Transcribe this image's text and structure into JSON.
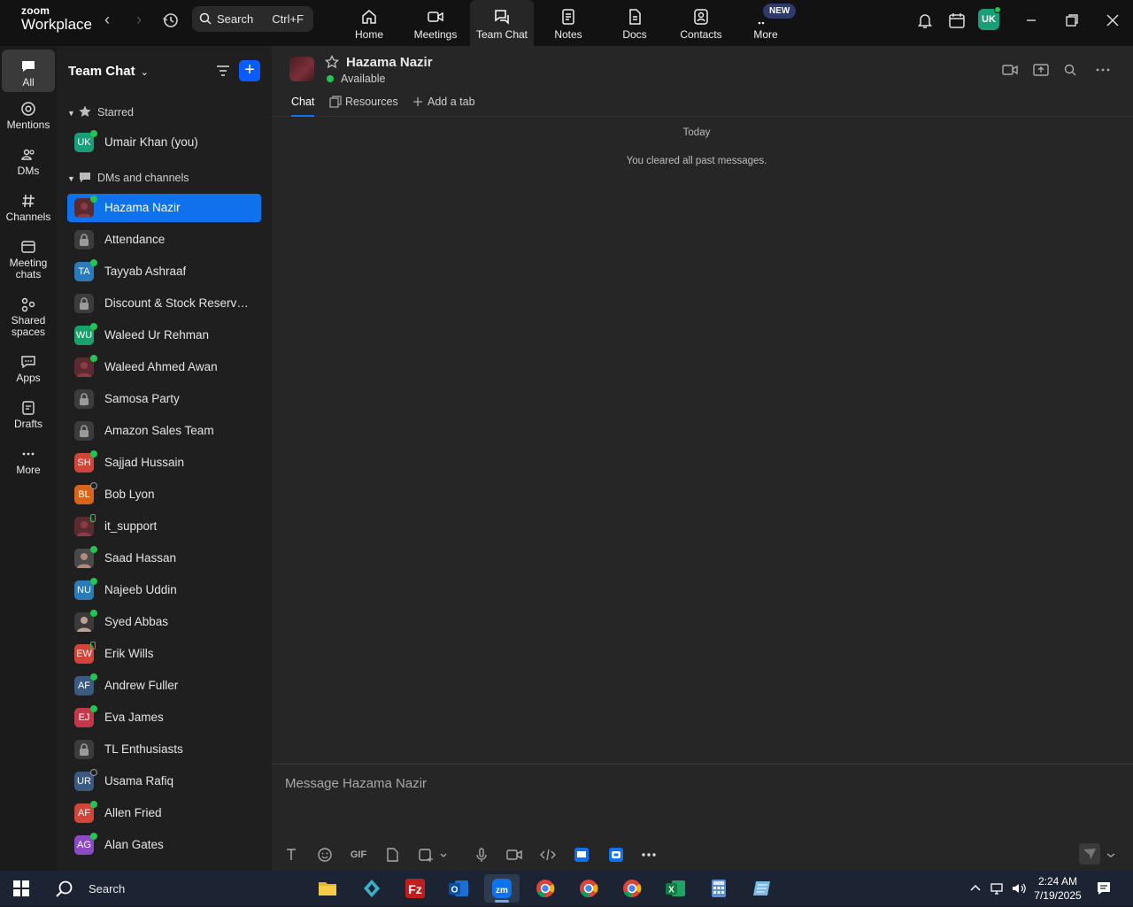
{
  "app": {
    "logo_top": "zoom",
    "logo_bottom": "Workplace"
  },
  "topbar": {
    "search_label": "Search",
    "search_shortcut": "Ctrl+F",
    "nav": [
      {
        "label": "Home",
        "icon": "home-icon"
      },
      {
        "label": "Meetings",
        "icon": "video-icon"
      },
      {
        "label": "Team Chat",
        "icon": "chat-icon"
      },
      {
        "label": "Notes",
        "icon": "notes-icon"
      },
      {
        "label": "Docs",
        "icon": "docs-icon"
      },
      {
        "label": "Contacts",
        "icon": "contacts-icon"
      },
      {
        "label": "More",
        "icon": "more-icon"
      }
    ],
    "new_badge": "NEW",
    "user_initials": "UK"
  },
  "rail": [
    {
      "label": "All"
    },
    {
      "label": "Mentions"
    },
    {
      "label": "DMs"
    },
    {
      "label": "Channels"
    },
    {
      "label": "Meeting chats"
    },
    {
      "label": "Shared spaces"
    },
    {
      "label": "Apps"
    },
    {
      "label": "Drafts"
    },
    {
      "label": "More"
    }
  ],
  "sidebar": {
    "title": "Team Chat",
    "starred_header": "Starred",
    "starred": [
      {
        "initials": "UK",
        "name": "Umair Khan (you)",
        "color": "#1a9e7a",
        "status": "on"
      }
    ],
    "dms_header": "DMs and channels",
    "items": [
      {
        "initials": "",
        "name": "Hazama Nazir",
        "type": "photo",
        "status": "on",
        "selected": true
      },
      {
        "initials": "",
        "name": "Attendance",
        "type": "lock"
      },
      {
        "initials": "TA",
        "name": "Tayyab Ashraaf",
        "color": "#2b7bb9",
        "status": "on"
      },
      {
        "initials": "",
        "name": "Discount & Stock Reservati...",
        "type": "lock"
      },
      {
        "initials": "WU",
        "name": "Waleed Ur Rehman",
        "color": "#1aa06b",
        "status": "on"
      },
      {
        "initials": "",
        "name": "Waleed Ahmed Awan",
        "type": "photo",
        "status": "on"
      },
      {
        "initials": "",
        "name": "Samosa Party",
        "type": "lock"
      },
      {
        "initials": "",
        "name": "Amazon Sales Team",
        "type": "lock"
      },
      {
        "initials": "SH",
        "name": "Sajjad Hussain",
        "color": "#d0443a",
        "status": "on"
      },
      {
        "initials": "BL",
        "name": "Bob Lyon",
        "color": "#d8641c",
        "status": "idle"
      },
      {
        "initials": "",
        "name": "it_support",
        "type": "photo",
        "status": "mob"
      },
      {
        "initials": "",
        "name": "Saad Hassan",
        "type": "photo",
        "status": "on"
      },
      {
        "initials": "NU",
        "name": "Najeeb Uddin",
        "color": "#2b7bb9",
        "status": "on"
      },
      {
        "initials": "",
        "name": "Syed Abbas",
        "type": "photo",
        "status": "on"
      },
      {
        "initials": "EW",
        "name": "Erik Wills",
        "color": "#d0443a",
        "status": "mob"
      },
      {
        "initials": "AF",
        "name": "Andrew Fuller",
        "color": "#3b5a82",
        "status": "on"
      },
      {
        "initials": "EJ",
        "name": "Eva James",
        "color": "#c2384a",
        "status": "on"
      },
      {
        "initials": "",
        "name": "TL Enthusiasts",
        "type": "lock"
      },
      {
        "initials": "UR",
        "name": "Usama Rafiq",
        "color": "#3b5a82",
        "status": "idle"
      },
      {
        "initials": "AF",
        "name": "Allen Fried",
        "color": "#d0443a",
        "status": "on"
      },
      {
        "initials": "AG",
        "name": "Alan Gates",
        "color": "#8b4bc2",
        "status": "on"
      }
    ]
  },
  "chat": {
    "name": "Hazama Nazir",
    "status": "Available",
    "tabs": [
      "Chat",
      "Resources",
      "Add a tab"
    ],
    "date_divider": "Today",
    "system_message": "You cleared all past messages.",
    "composer_placeholder": "Message Hazama Nazir",
    "gif_label": "GIF"
  },
  "taskbar": {
    "search_label": "Search",
    "time": "2:24 AM",
    "date": "7/19/2025"
  }
}
